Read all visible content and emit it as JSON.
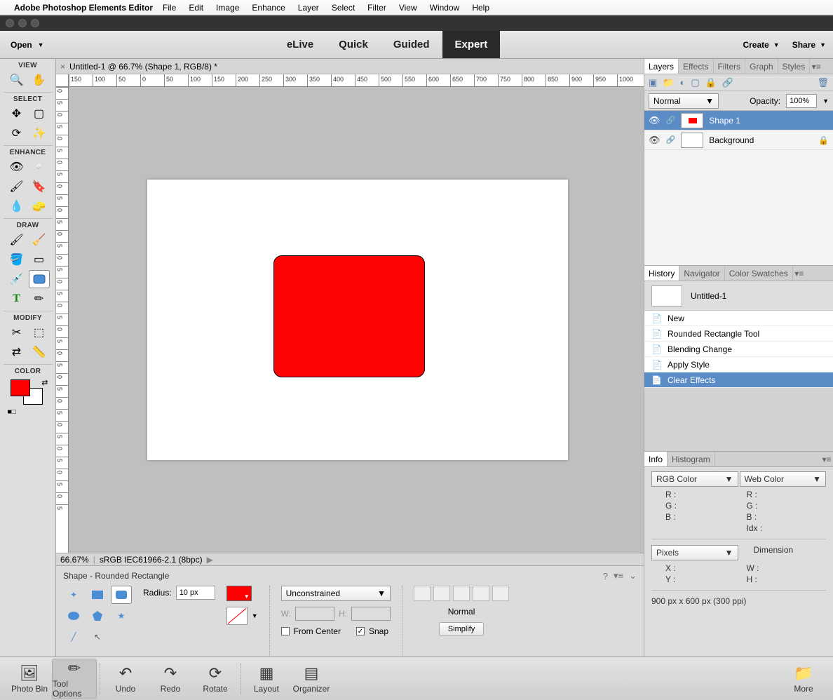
{
  "menubar": {
    "app": "Adobe Photoshop Elements Editor",
    "items": [
      "File",
      "Edit",
      "Image",
      "Enhance",
      "Layer",
      "Select",
      "Filter",
      "View",
      "Window",
      "Help"
    ]
  },
  "chrome": {
    "open": "Open",
    "modes": [
      "eLive",
      "Quick",
      "Guided",
      "Expert"
    ],
    "active_mode": "Expert",
    "create": "Create",
    "share": "Share"
  },
  "toolbox": {
    "sections": [
      "VIEW",
      "SELECT",
      "ENHANCE",
      "DRAW",
      "MODIFY",
      "COLOR"
    ]
  },
  "tab": {
    "title": "Untitled-1 @ 66.7% (Shape 1, RGB/8) *"
  },
  "ruler": {
    "h": [
      "150",
      "100",
      "50",
      "0",
      "50",
      "100",
      "150",
      "200",
      "250",
      "300",
      "350",
      "400",
      "450",
      "500",
      "550",
      "600",
      "650",
      "700",
      "750",
      "800",
      "850",
      "900",
      "950",
      "1000"
    ],
    "v": [
      "0",
      "5",
      "0",
      "5",
      "0",
      "5",
      "0",
      "5",
      "0",
      "5",
      "0",
      "5",
      "0",
      "5",
      "0",
      "5",
      "0",
      "5",
      "0",
      "5",
      "0",
      "5",
      "0",
      "5",
      "0",
      "5",
      "0",
      "5",
      "0",
      "5",
      "0",
      "5",
      "0",
      "5",
      "0",
      "5"
    ]
  },
  "status": {
    "zoom": "66.67%",
    "profile": "sRGB IEC61966-2.1 (8bpc)"
  },
  "options": {
    "title": "Shape - Rounded Rectangle",
    "radius_label": "Radius:",
    "radius": "10 px",
    "mode": "Unconstrained",
    "w": "W:",
    "h": "H:",
    "from_center": "From Center",
    "snap": "Snap",
    "normal": "Normal",
    "simplify": "Simplify"
  },
  "layers_panel": {
    "tabs": [
      "Layers",
      "Effects",
      "Filters",
      "Graph",
      "Styles"
    ],
    "blend": "Normal",
    "opacity_label": "Opacity:",
    "opacity": "100%",
    "layers": [
      {
        "name": "Shape 1",
        "sel": true
      },
      {
        "name": "Background",
        "sel": false
      }
    ]
  },
  "history_panel": {
    "tabs": [
      "History",
      "Navigator",
      "Color Swatches"
    ],
    "doc": "Untitled-1",
    "items": [
      "New",
      "Rounded Rectangle Tool",
      "Blending Change",
      "Apply Style",
      "Clear Effects"
    ],
    "sel": 4
  },
  "info_panel": {
    "tabs": [
      "Info",
      "Histogram"
    ],
    "rgb": "RGB Color",
    "web": "Web Color",
    "channels": [
      [
        "R :",
        "R :"
      ],
      [
        "G :",
        "G :"
      ],
      [
        "B :",
        "B :"
      ],
      [
        "",
        "Idx :"
      ]
    ],
    "units": "Pixels",
    "dim_label": "Dimension",
    "xy": [
      [
        "X :",
        "W :"
      ],
      [
        "Y :",
        "H :"
      ]
    ],
    "doc_dim": "900 px x 600 px (300 ppi)"
  },
  "bottom": {
    "items": [
      "Photo Bin",
      "Tool Options",
      "Undo",
      "Redo",
      "Rotate",
      "Layout",
      "Organizer"
    ],
    "more": "More",
    "sel": 1
  }
}
